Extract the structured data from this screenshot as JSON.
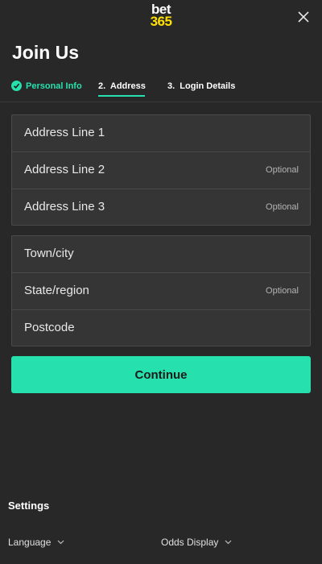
{
  "header": {
    "logo_line1": "bet",
    "logo_line2": "365",
    "title": "Join Us"
  },
  "steps": [
    {
      "label": "Personal Info",
      "state": "complete"
    },
    {
      "label": "2.  Address",
      "state": "active"
    },
    {
      "label": "3.  Login Details",
      "state": "pending"
    }
  ],
  "form": {
    "group1": [
      {
        "label": "Address Line 1",
        "optional": ""
      },
      {
        "label": "Address Line 2",
        "optional": "Optional"
      },
      {
        "label": "Address Line 3",
        "optional": "Optional"
      }
    ],
    "group2": [
      {
        "label": "Town/city",
        "optional": ""
      },
      {
        "label": "State/region",
        "optional": "Optional"
      },
      {
        "label": "Postcode",
        "optional": ""
      }
    ],
    "continue_label": "Continue"
  },
  "settings": {
    "title": "Settings",
    "language_label": "Language",
    "odds_label": "Odds Display"
  },
  "colors": {
    "accent": "#26e1ae",
    "logo_yellow": "#ffe000",
    "background": "#282828",
    "field_background": "#353535"
  },
  "icons": [
    "close-icon",
    "check-circle-icon",
    "chevron-down-icon"
  ]
}
